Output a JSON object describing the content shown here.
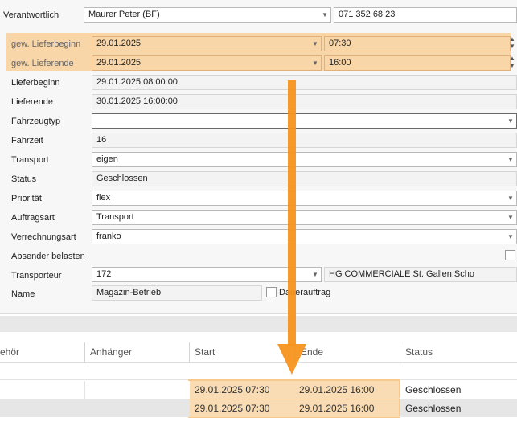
{
  "form": {
    "verantwortlich": {
      "label": "Verantwortlich",
      "value": "Maurer Peter (BF)",
      "phone": "071 352 68 23"
    },
    "gew_lieferbeginn": {
      "label": "gew. Lieferbeginn",
      "date": "29.01.2025",
      "time": "07:30"
    },
    "gew_lieferende": {
      "label": "gew. Lieferende",
      "date": "29.01.2025",
      "time": "16:00"
    },
    "lieferbeginn": {
      "label": "Lieferbeginn",
      "value": "29.01.2025 08:00:00"
    },
    "lieferende": {
      "label": "Lieferende",
      "value": "30.01.2025 16:00:00"
    },
    "fahrzeugtyp": {
      "label": "Fahrzeugtyp",
      "value": ""
    },
    "fahrzeit": {
      "label": "Fahrzeit",
      "value": "16"
    },
    "transport": {
      "label": "Transport",
      "value": "eigen"
    },
    "status": {
      "label": "Status",
      "value": "Geschlossen"
    },
    "prioritaet": {
      "label": "Priorität",
      "value": "flex"
    },
    "auftragsart": {
      "label": "Auftragsart",
      "value": "Transport"
    },
    "verrechnungsart": {
      "label": "Verrechnungsart",
      "value": "franko"
    },
    "absender_belasten": {
      "label": "Absender belasten"
    },
    "transporteur": {
      "label": "Transporteur",
      "value": "172",
      "name": "HG COMMERCIALE St. Gallen,Scho"
    },
    "name": {
      "label": "Name",
      "value": "Magazin-Betrieb"
    },
    "dauerauftrag": {
      "label": "Dauerauftrag"
    }
  },
  "grid": {
    "columns": [
      "ehör",
      "Anhänger",
      "Start",
      "Ende",
      "Status"
    ],
    "rows": [
      {
        "start": "29.01.2025 07:30",
        "ende": "29.01.2025 16:00",
        "status": "Geschlossen"
      },
      {
        "start": "29.01.2025 07:30",
        "ende": "29.01.2025 16:00",
        "status": "Geschlossen"
      }
    ]
  },
  "colors": {
    "highlight": "#f8d6a8",
    "arrow": "#f7941d"
  }
}
